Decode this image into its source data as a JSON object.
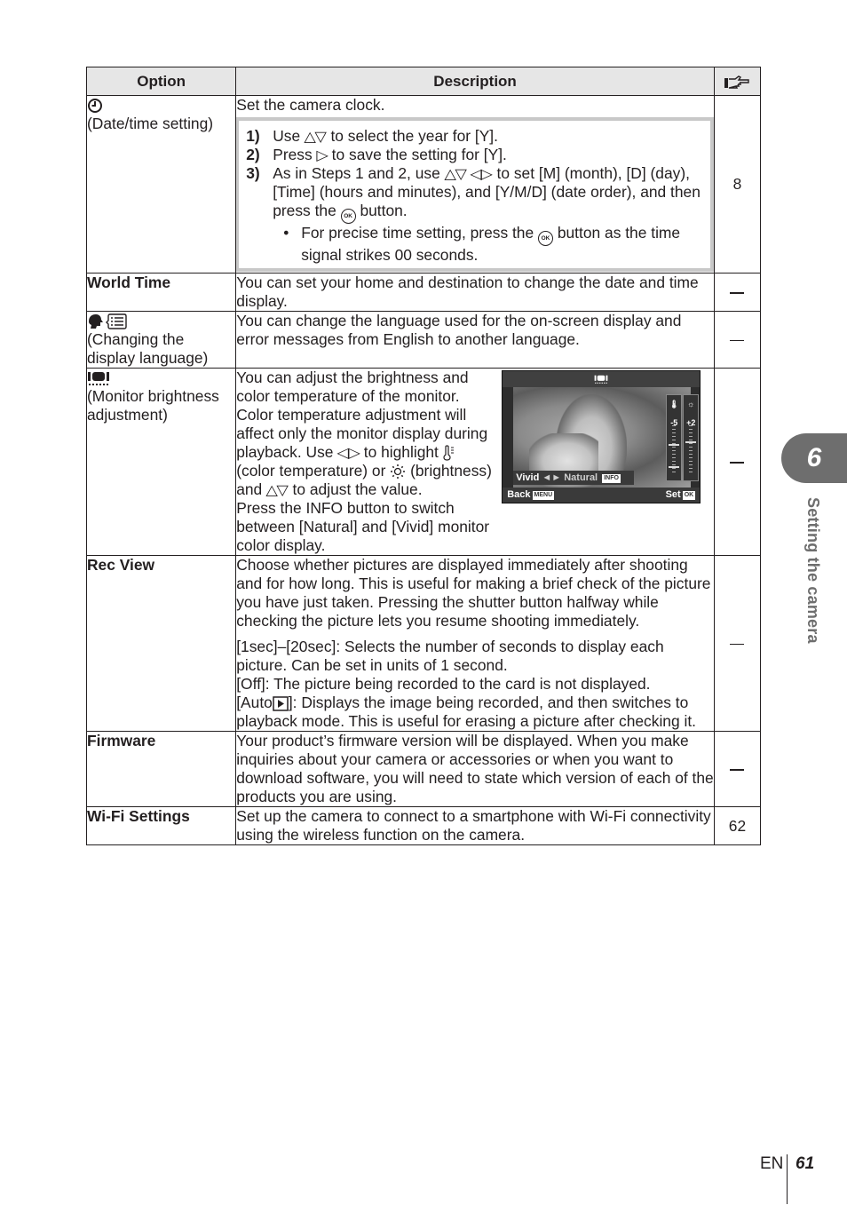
{
  "table": {
    "headers": {
      "option": "Option",
      "description": "Description",
      "ref_icon": "page-reference-hand-icon"
    },
    "rows": [
      {
        "option_icon": "clock-icon",
        "option_label": "(Date/time setting)",
        "intro": "Set the camera clock.",
        "steps": [
          {
            "num": "1)",
            "parts": [
              "Use",
              "to select the year for [Y]."
            ]
          },
          {
            "num": "2)",
            "parts": [
              "Press",
              "to save the setting for [Y]."
            ]
          },
          {
            "num": "3)",
            "parts": [
              "As in Steps 1 and 2, use",
              "to set [M] (month), [D] (day), [Time] (hours and minutes), and [Y/M/D] (date order), and then press the",
              "button."
            ]
          }
        ],
        "bullet": {
          "dot": "•",
          "parts": [
            "For precise time setting, press the",
            "button as the time signal strikes 00 seconds."
          ]
        },
        "ok_label": "OK",
        "ref": "8"
      },
      {
        "option_label": "World Time",
        "description": "You can set your home and destination to change the date and time display.",
        "ref": "—"
      },
      {
        "option_icon": "display-language-icon",
        "option_label": "(Changing the display language)",
        "description": "You can change the language used for the on-screen display and error messages from English to another language.",
        "ref": "—"
      },
      {
        "option_icon": "monitor-brightness-icon",
        "option_label": "(Monitor brightness adjustment)",
        "description_parts": [
          "You can adjust the brightness and color temperature of the monitor. Color temperature adjustment will affect only the monitor display during playback. Use",
          "to highlight",
          "(color temperature) or",
          "(brightness) and",
          "to adjust the value."
        ],
        "description_2": "Press the INFO button to switch between [Natural] and [Vivid] monitor color display.",
        "screen": {
          "color_temp_value": "-5",
          "brightness_value": "+2",
          "mode_left": "Vivid",
          "mode_arrows": "◄►",
          "mode_right": "Natural",
          "info_tag": "INFO",
          "back_label": "Back",
          "menu_tag": "MENU",
          "set_label": "Set",
          "ok_tag": "OK"
        },
        "ref": "—"
      },
      {
        "option_label": "Rec View",
        "description": "Choose whether pictures are displayed immediately after shooting and for how long. This is useful for making a brief check of the picture you have just taken. Pressing the shutter button halfway while checking the picture lets you resume shooting immediately.",
        "description_2": "[1sec]–[20sec]: Selects the number of seconds to display each picture. Can be set in units of 1 second.",
        "description_3": "[Off]: The picture being recorded to the card is not displayed.",
        "description_4_parts": [
          "[Auto",
          "]: Displays the image being recorded, and then switches to playback mode. This is useful for erasing a picture after checking it."
        ],
        "ref": "—"
      },
      {
        "option_label": "Firmware",
        "description": "Your product’s firmware version will be displayed. When you make inquiries about your camera or accessories or when you want to download software, you will need to state which version of each of the products you are using.",
        "ref": "—"
      },
      {
        "option_label": "Wi-Fi Settings",
        "description": "Set up the camera to connect to a smartphone with Wi-Fi connectivity using the wireless function on the camera.",
        "ref": "62"
      }
    ]
  },
  "sidebar": {
    "chapter_number": "6",
    "chapter_title": "Setting the camera",
    "accent_color": "#6e6e6e"
  },
  "footer": {
    "language": "EN",
    "page_number": "61"
  }
}
